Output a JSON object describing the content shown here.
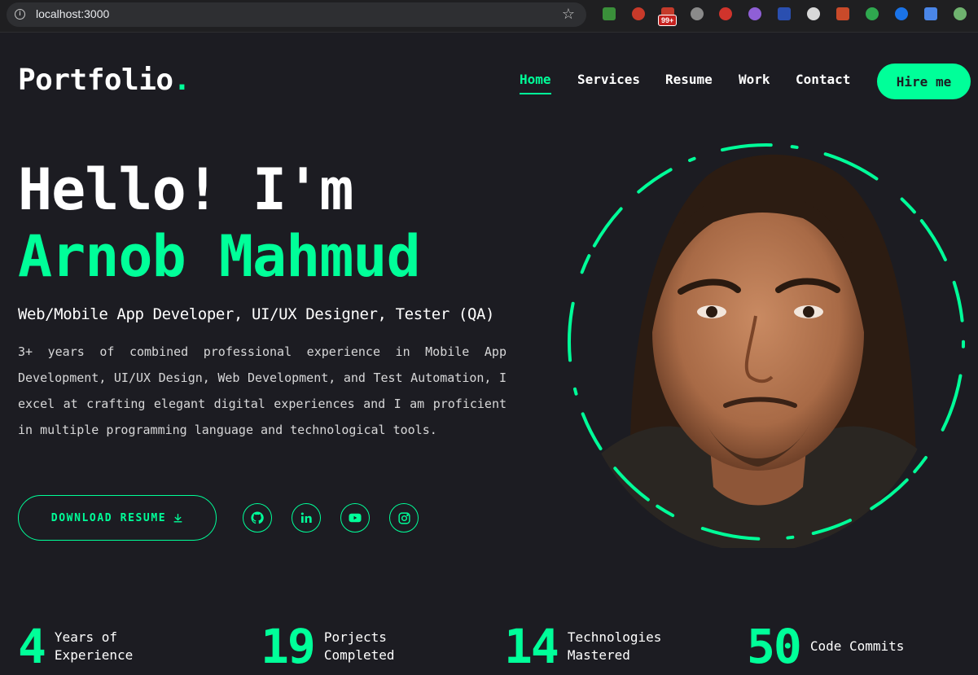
{
  "browser": {
    "url": "localhost:3000",
    "extension_badge": "99+"
  },
  "nav": {
    "logo_text": "Portfolio",
    "logo_dot": ".",
    "items": [
      {
        "label": "Home"
      },
      {
        "label": "Services"
      },
      {
        "label": "Resume"
      },
      {
        "label": "Work"
      },
      {
        "label": "Contact"
      }
    ],
    "hire_label": "Hire me"
  },
  "hero": {
    "greeting": "Hello! I'm",
    "name": "Arnob Mahmud",
    "role": "Web/Mobile App Developer, UI/UX Designer, Tester (QA)",
    "bio": "3+ years of combined professional experience in Mobile App Development, UI/UX Design, Web Development, and Test Automation, I excel at crafting elegant digital experiences and I am proficient in multiple programming language and technological tools.",
    "download_label": "DOWNLOAD RESUME",
    "socials": [
      "github-icon",
      "linkedin-icon",
      "youtube-icon",
      "instagram-icon"
    ]
  },
  "stats": [
    {
      "number": "4",
      "label": "Years of Experience"
    },
    {
      "number": "19",
      "label": "Porjects Completed"
    },
    {
      "number": "14",
      "label": "Technologies Mastered"
    },
    {
      "number": "50",
      "label": "Code Commits"
    }
  ],
  "colors": {
    "accent": "#00ff99",
    "background": "#1c1c22",
    "text": "#ffffff"
  }
}
